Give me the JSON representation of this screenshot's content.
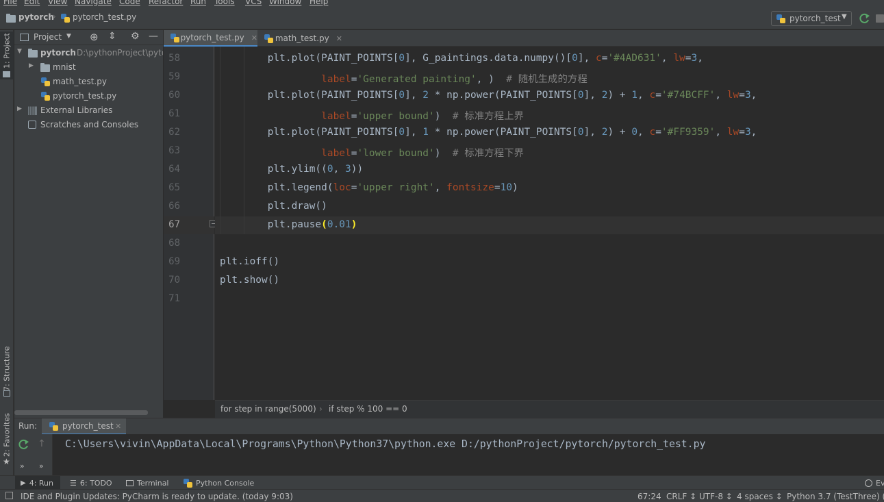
{
  "menu": [
    "File",
    "Edit",
    "View",
    "Navigate",
    "Code",
    "Refactor",
    "Run",
    "Tools",
    "VCS",
    "Window",
    "Help"
  ],
  "navbar": {
    "project": "pytorch",
    "file": "pytorch_test.py",
    "run_config": "pytorch_test"
  },
  "left_stripe": {
    "project_tab": "1: Project",
    "structure_tab": "7: Structure",
    "favorites_tab": "2: Favorites"
  },
  "project_panel": {
    "title": "Project",
    "tree": [
      {
        "label": "pytorch",
        "path": "D:\\pythonProject\\pytorch"
      },
      {
        "label": "mnist"
      },
      {
        "label": "math_test.py"
      },
      {
        "label": "pytorch_test.py"
      },
      {
        "label": "External Libraries"
      },
      {
        "label": "Scratches and Consoles"
      }
    ]
  },
  "editor": {
    "tabs": [
      {
        "label": "pytorch_test.py",
        "active": true
      },
      {
        "label": "math_test.py",
        "active": false
      }
    ],
    "line_numbers": [
      "58",
      "59",
      "60",
      "61",
      "62",
      "63",
      "64",
      "65",
      "66",
      "67",
      "68",
      "69",
      "70",
      "71"
    ],
    "current_line": "67",
    "breadcrumb": [
      "for step in range(5000)",
      "if step % 100 == 0"
    ]
  },
  "run": {
    "label": "Run:",
    "tab": "pytorch_test",
    "console": "C:\\Users\\vivin\\AppData\\Local\\Programs\\Python\\Python37\\python.exe D:/pythonProject/pytorch/pytorch_test.py"
  },
  "bottom_tabs": [
    "4: Run",
    "6: TODO",
    "Terminal",
    "Python Console"
  ],
  "status": {
    "message": "IDE and Plugin Updates: PyCharm is ready to update. (today 9:03)",
    "position": "67:24",
    "line_sep": "CRLF ↕",
    "encoding": "UTF-8 ↕",
    "indent": "4 spaces ↕",
    "interpreter": "Python 3.7 (TestThree) (2)",
    "event_log": "Ev"
  },
  "colors": {
    "accent": "#4a88c7",
    "keyword_arg": "#aa4926",
    "string": "#6a8759",
    "number": "#6897bb",
    "comment": "#808080"
  }
}
